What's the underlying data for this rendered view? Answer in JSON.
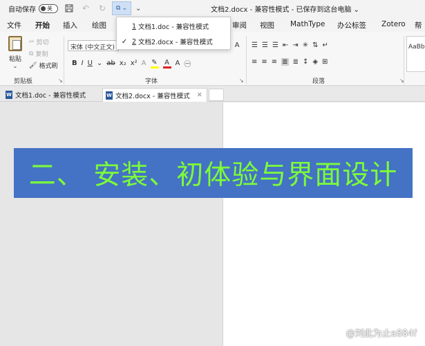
{
  "titlebar": {
    "autosave_label": "自动保存",
    "autosave_state": "关",
    "doc_title": "文档2.docx - 兼容性模式 - 已保存到这台电脑 ⌄"
  },
  "menu": {
    "tabs": [
      "文件",
      "开始",
      "插入",
      "绘图",
      "审阅",
      "视图",
      "MathType",
      "办公标签",
      "Zotero",
      "帮"
    ],
    "active": "开始"
  },
  "ribbon": {
    "paste_label": "粘贴",
    "cut_label": "剪切",
    "copy_label": "复制",
    "format_painter_label": "格式刷",
    "clipboard_group": "剪贴板",
    "font_name": "宋体 (中文正文)",
    "font_group": "字体",
    "paragraph_group": "段落",
    "bold": "B",
    "italic": "I",
    "underline": "U",
    "strike": "ab",
    "subscript": "x₂",
    "superscript": "x²",
    "text_effect": "A",
    "font_color": "A",
    "style_preview": "AaBb"
  },
  "dropdown": {
    "items": [
      {
        "num": "1",
        "label": "文档1.doc  -  兼容性模式",
        "checked": ""
      },
      {
        "num": "2",
        "label": "文档2.docx  -  兼容性模式",
        "checked": "✓"
      }
    ]
  },
  "doc_tabs": [
    {
      "label": "文档1.doc  -  兼容性模式",
      "active": false
    },
    {
      "label": "文档2.docx  -  兼容性模式",
      "active": true
    }
  ],
  "banner": {
    "text": "二、 安装、初体验与界面设计",
    "bg_color": "#4472c4",
    "text_color": "#7cfc3a"
  },
  "watermark": "@刘此为止a884f",
  "colors": {
    "accent": "#2b579a",
    "highlight": "#ffff00",
    "font_color": "#e02020"
  }
}
